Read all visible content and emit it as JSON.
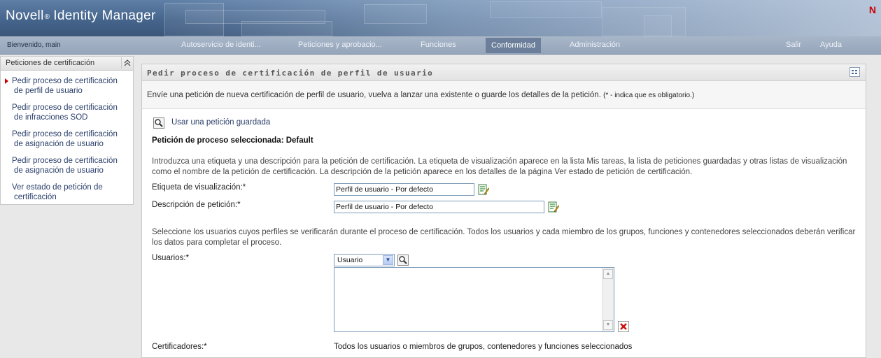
{
  "header": {
    "brand_name": "Novell",
    "brand_reg": "®",
    "product_name": "Identity Manager",
    "corner_logo": "N",
    "brand_color": "#cc0000"
  },
  "navbar": {
    "welcome": "Bienvenido, main",
    "tabs": [
      {
        "label": "Autoservicio de identi..."
      },
      {
        "label": "Peticiones y aprobacio..."
      },
      {
        "label": "Funciones"
      },
      {
        "label": "Conformidad",
        "active": true
      },
      {
        "label": "Administración"
      }
    ],
    "logout": "Salir",
    "help": "Ayuda"
  },
  "sidebar": {
    "title": "Peticiones de certificación",
    "collapse_icon": "double-chevron-up-icon",
    "items": [
      {
        "line1": "Pedir proceso de certificación",
        "line2": "de perfil de usuario",
        "selected": true
      },
      {
        "line1": "Pedir proceso de certificación",
        "line2": "de infracciones SOD"
      },
      {
        "line1": "Pedir proceso de certificación",
        "line2": "de asignación de usuario"
      },
      {
        "line1": "Pedir proceso de certificación",
        "line2": "de asignación de usuario"
      },
      {
        "line1": "Ver estado de petición de",
        "line2": "certificación"
      }
    ]
  },
  "main": {
    "title": "Pedir proceso de certificación de perfil de usuario",
    "description": "Envíe una petición de nueva certificación de perfil de usuario, vuelva a lanzar una existente o guarde los detalles de la petición.",
    "required_note": "(* - indica que es obligatorio.)",
    "use_saved_link": "Usar una petición guardada",
    "selected_process": "Petición de proceso seleccionada: Default",
    "intro_paragraph": "Introduzca una etiqueta y una descripción para la petición de certificación. La etiqueta de visualización aparece en la lista Mis tareas, la lista de peticiones guardadas y otras listas de visualización como el nombre de la petición de certificación. La descripción de la petición aparece en los detalles de la página Ver estado de petición de certificación.",
    "display_label": {
      "label": "Etiqueta de visualización:*",
      "value": "Perfil de usuario - Por defecto"
    },
    "request_description": {
      "label": "Descripción de petición:*",
      "value": "Perfil de usuario - Por defecto"
    },
    "users_paragraph": "Seleccione los usuarios cuyos perfiles se verificarán durante el proceso de certificación. Todos los usuarios y cada miembro de los grupos, funciones y contenedores seleccionados deberán verificar los datos para completar el proceso.",
    "users": {
      "label": "Usuarios:*",
      "type_selected": "Usuario"
    },
    "certifiers": {
      "label": "Certificadores:*",
      "value": "Todos los usuarios o miembros de grupos, contenedores y funciones seleccionados"
    }
  }
}
